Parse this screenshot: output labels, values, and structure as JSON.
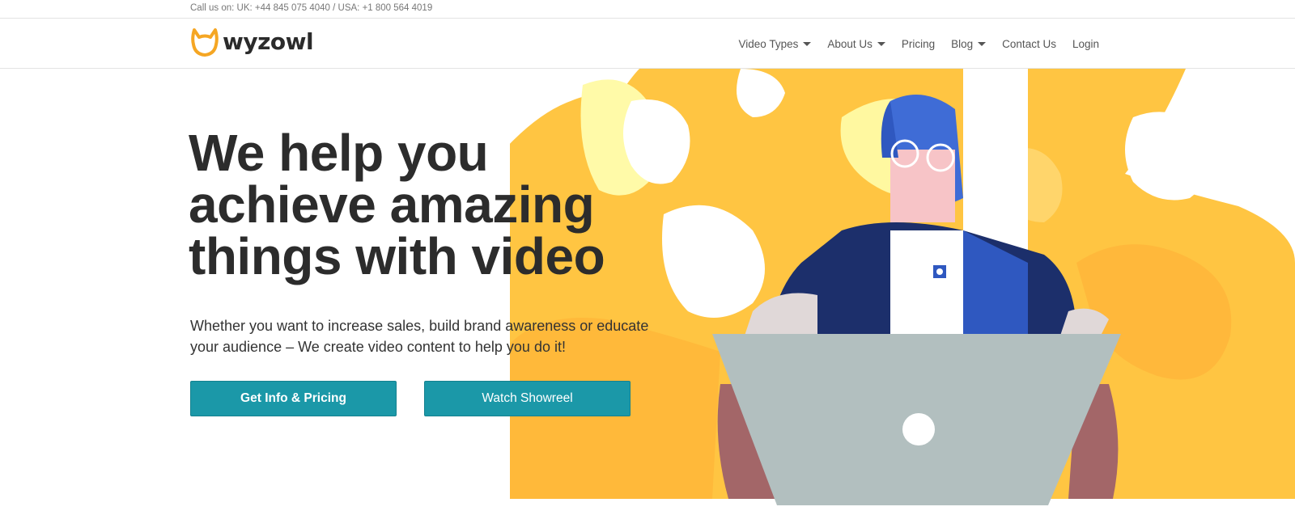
{
  "topbar": {
    "phone": "Call us on: UK: +44 845 075 4040 / USA: +1 800 564 4019"
  },
  "brand": {
    "name": "wyzowl",
    "logo_icon": "cat-face-icon",
    "accent": "#f5a623"
  },
  "nav": {
    "items": [
      {
        "label": "Video Types",
        "dropdown": true
      },
      {
        "label": "About Us",
        "dropdown": true
      },
      {
        "label": "Pricing",
        "dropdown": false
      },
      {
        "label": "Blog",
        "dropdown": true
      },
      {
        "label": "Contact Us",
        "dropdown": false
      },
      {
        "label": "Login",
        "dropdown": false
      }
    ]
  },
  "hero": {
    "title_lines": [
      "We help you",
      "achieve amazing",
      "things with video"
    ],
    "subtitle_lines": [
      "Whether you want to increase sales, build brand awareness or educate",
      "your audience – We create video content to help you do it!"
    ],
    "primary_button": "Get Info & Pricing",
    "secondary_button": "Watch Showreel",
    "button_color": "#1b98a8"
  },
  "illustration": {
    "subject": "person-at-laptop",
    "colors": {
      "yellow": "#ffc542",
      "blue": "#3f6cd6",
      "navy": "#1c2f6b",
      "laptop": "#b2bfbf"
    }
  }
}
